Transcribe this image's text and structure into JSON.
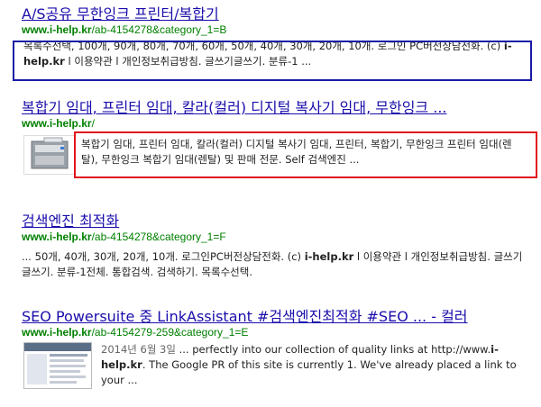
{
  "results": [
    {
      "title": "A/S공유  무한잉크 프린터/복합기",
      "url_domain": "www.i-help.kr",
      "url_path": "/ab-4154278&category_1=B",
      "snippet_1": "목록수선택, 100개, 90개, 80개, 70개, 60개, 50개, 40개, 30개, 20개, 10개. 로그인 PC버전상담전화. (c) ",
      "snippet_bold": "i-help.kr",
      "snippet_2": " l 이용약관 l 개인정보취급방침. 글쓰기글쓰기. 분류-1  ...",
      "highlight_color": "#1a1aa6"
    },
    {
      "title": "복합기 임대, 프린터 임대, 칼라(컬러) 디지털 복사기 임대, 무한잉크 ...",
      "url_domain": "www.i-help.kr",
      "url_path": "/",
      "snippet": "복합기 임대, 프린터 임대, 칼라(컬러) 디지털 복사기 임대, 프린터, 복합기, 무한잉크 프린터 임대(렌탈), 무한잉크 복합기 임대(렌탈) 및 판매 전문. Self 검색엔진 ...",
      "thumbnail_icon": "printer-icon",
      "highlight_color": "#e0141e"
    },
    {
      "title": "검색엔진 최적화",
      "url_domain": "www.i-help.kr",
      "url_path": "/ab-4154278&category_1=F",
      "snippet_1": "... 50개, 40개, 30개, 20개, 10개. 로그인PC버전상담전화. (c) ",
      "snippet_bold": "i-help.kr",
      "snippet_2": " l 이용약관 l 개인정보취급방침. 글쓰기글쓰기. 분류-1전체. 통합검색. 검색하기. 목록수선택."
    },
    {
      "title": "SEO Powersuite 중 LinkAssistant #검색엔진최적화 #SEO ... - 컬러",
      "url_domain": "www.i-help.kr",
      "url_path": "/ab-4154279-259&category_1=E",
      "date": "2014년 6월 3일",
      "snippet_1": " ... perfectly into our collection of quality links at http://www.",
      "snippet_bold": "i-help.kr",
      "snippet_2": ". The Google PR of this site is currently 1. We've already placed a link to your ...",
      "thumbnail_icon": "webpage-screenshot-icon"
    }
  ]
}
